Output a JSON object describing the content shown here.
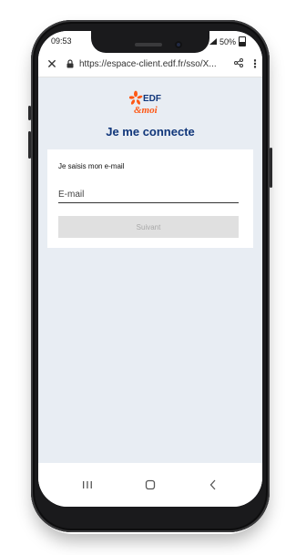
{
  "status": {
    "time": "09:53",
    "battery": "50%"
  },
  "browser": {
    "url": "https://espace-client.edf.fr/sso/X..."
  },
  "logo": {
    "brand": "EDF",
    "tagline": "&moi"
  },
  "page": {
    "title": "Je me connecte"
  },
  "form": {
    "label": "Je saisis mon e-mail",
    "email_placeholder": "E-mail",
    "email_value": "",
    "next_label": "Suivant"
  },
  "colors": {
    "title": "#10367a",
    "accent": "#fe5815",
    "background": "#e8edf3"
  },
  "icons": {
    "close": "close-icon",
    "lock": "lock-icon",
    "share": "share-icon",
    "menu": "more-vert-icon",
    "recents": "recents-icon",
    "home": "home-icon",
    "back": "back-icon"
  }
}
